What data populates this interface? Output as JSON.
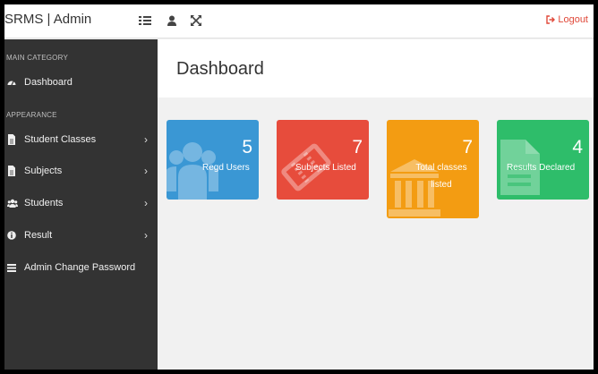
{
  "app": {
    "brand": "SRMS | Admin"
  },
  "topbar": {
    "logout_label": "Logout"
  },
  "sidebar": {
    "categories": [
      "MAIN CATEGORY",
      "APPEARANCE"
    ],
    "items": [
      {
        "label": "Dashboard",
        "icon": "dashboard-icon"
      },
      {
        "label": "Student Classes",
        "icon": "file-icon",
        "has_children": true
      },
      {
        "label": "Subjects",
        "icon": "file-icon",
        "has_children": true
      },
      {
        "label": "Students",
        "icon": "users-icon",
        "has_children": true
      },
      {
        "label": "Result",
        "icon": "info-icon",
        "has_children": true
      },
      {
        "label": "Admin Change Password",
        "icon": "list-icon"
      }
    ],
    "chevron": "›"
  },
  "main": {
    "title": "Dashboard"
  },
  "stats": [
    {
      "value": "5",
      "label": "Regd Users",
      "color": "#3a97d4",
      "icon": "users-icon"
    },
    {
      "value": "7",
      "label": "Subjects Listed",
      "color": "#e74c3c",
      "icon": "ticket-icon"
    },
    {
      "value": "7",
      "label": "Total classes listed",
      "color": "#f39c12",
      "icon": "bank-icon"
    },
    {
      "value": "4",
      "label": "Results Declared",
      "color": "#2ebd6a",
      "icon": "file-text-icon"
    }
  ],
  "colors": {
    "sidebar_bg": "#333333",
    "logout": "#e0493a",
    "content_bg": "#f1f1f1"
  }
}
